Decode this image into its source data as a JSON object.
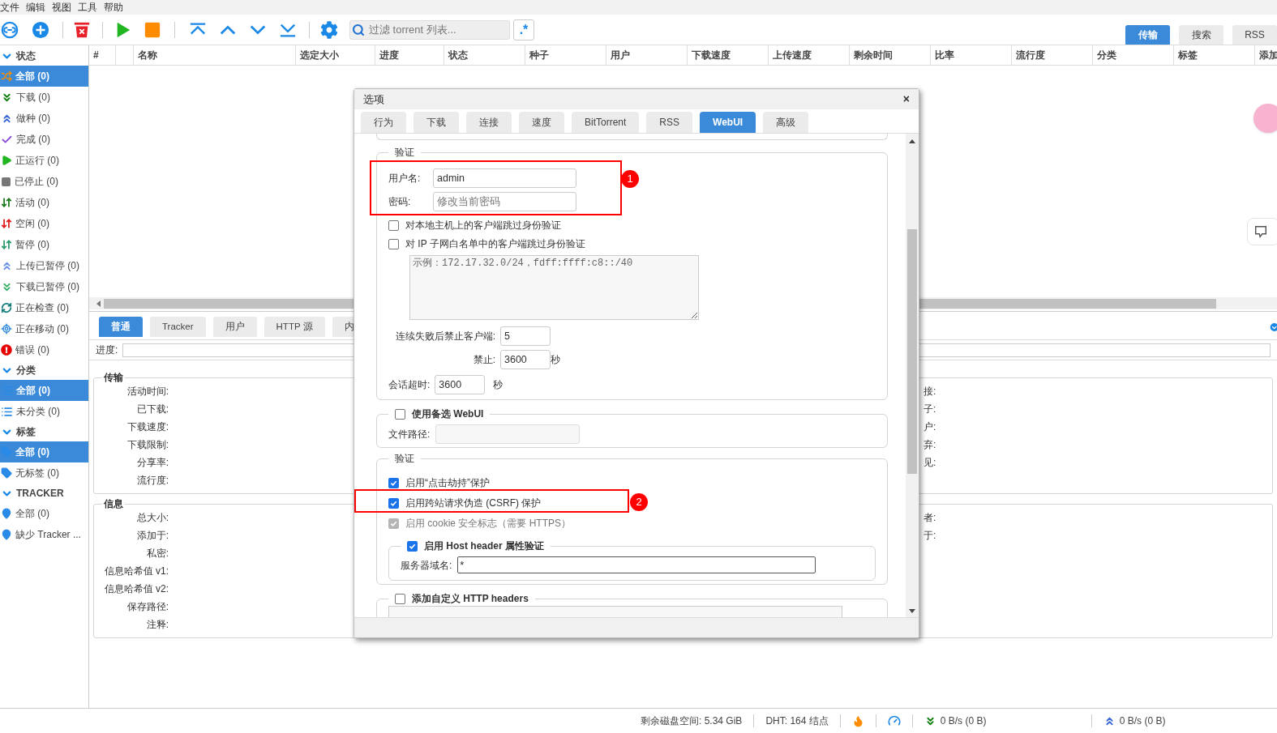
{
  "menu": [
    "文件",
    "编辑",
    "视图",
    "工具",
    "帮助"
  ],
  "toolbar": {
    "filter_placeholder": "过滤 torrent 列表...",
    "regex_button": ".*"
  },
  "view_tabs": [
    {
      "label": "传输",
      "selected": true
    },
    {
      "label": "搜索",
      "selected": false
    },
    {
      "label": "RSS",
      "selected": false
    }
  ],
  "sidebar": [
    {
      "title": "状态",
      "expanded": true,
      "items": [
        {
          "label": "全部 (0)",
          "kind": "all",
          "selected": true
        },
        {
          "label": "下载 (0)",
          "kind": "downloading",
          "selected": false
        },
        {
          "label": "做种 (0)",
          "kind": "seeding",
          "selected": false
        },
        {
          "label": "完成 (0)",
          "kind": "completed",
          "selected": false
        },
        {
          "label": "正运行 (0)",
          "kind": "running",
          "selected": false
        },
        {
          "label": "已停止 (0)",
          "kind": "stopped",
          "selected": false
        },
        {
          "label": "活动 (0)",
          "kind": "active",
          "selected": false
        },
        {
          "label": "空闲 (0)",
          "kind": "inactive",
          "selected": false
        },
        {
          "label": "暂停 (0)",
          "kind": "stalled",
          "selected": false
        },
        {
          "label": "上传已暂停 (0)",
          "kind": "stalled_up",
          "selected": false
        },
        {
          "label": "下载已暂停 (0)",
          "kind": "stalled_down",
          "selected": false
        },
        {
          "label": "正在检查 (0)",
          "kind": "checking",
          "selected": false
        },
        {
          "label": "正在移动 (0)",
          "kind": "moving",
          "selected": false
        },
        {
          "label": "错误 (0)",
          "kind": "error",
          "selected": false
        }
      ]
    },
    {
      "title": "分类",
      "expanded": true,
      "items": [
        {
          "label": "全部 (0)",
          "kind": "list",
          "selected": true
        },
        {
          "label": "未分类 (0)",
          "kind": "list",
          "selected": false
        }
      ]
    },
    {
      "title": "标签",
      "expanded": true,
      "items": [
        {
          "label": "全部 (0)",
          "kind": "tag",
          "selected": true
        },
        {
          "label": "无标签 (0)",
          "kind": "tag",
          "selected": false
        }
      ]
    },
    {
      "title": "TRACKER",
      "expanded": true,
      "items": [
        {
          "label": "全部 (0)",
          "kind": "pin",
          "selected": false
        },
        {
          "label": "缺少 Tracker ...",
          "kind": "pin",
          "selected": false
        }
      ]
    }
  ],
  "table": {
    "columns": [
      "#",
      "名称",
      "选定大小",
      "进度",
      "状态",
      "种子",
      "用户",
      "下载速度",
      "上传速度",
      "剩余时间",
      "比率",
      "流行度",
      "分类",
      "标签",
      "添加"
    ]
  },
  "details": {
    "tabs": [
      {
        "label": "普通",
        "selected": true
      },
      {
        "label": "Tracker",
        "selected": false
      },
      {
        "label": "用户",
        "selected": false
      },
      {
        "label": "HTTP 源",
        "selected": false
      },
      {
        "label": "内",
        "selected": false
      }
    ],
    "progress_label": "进度:",
    "progress": {
      "level": 0
    },
    "transfer": {
      "title": "传输",
      "labels": [
        "活动时间:",
        "已下载:",
        "下载速度:",
        "下载限制:",
        "分享率:",
        "流行度:"
      ],
      "right_labels": [
        "接:",
        "子:",
        "户:",
        "弃:",
        "见:"
      ]
    },
    "info": {
      "title": "信息",
      "labels": [
        "总大小:",
        "添加于:",
        "私密:",
        "信息哈希值 v1:",
        "信息哈希值 v2:",
        "保存路径:",
        "注释:"
      ],
      "right_labels": [
        "者:",
        "于:"
      ]
    }
  },
  "status_bar": {
    "free_space": "剩余磁盘空间: 5.34 GiB",
    "dht": "DHT: 164 结点",
    "download": "0 B/s (0 B)",
    "upload": "0 B/s (0 B)"
  },
  "dialog": {
    "title": "选项",
    "close": "×",
    "tabs": [
      {
        "label": "行为",
        "selected": false
      },
      {
        "label": "下载",
        "selected": false
      },
      {
        "label": "连接",
        "selected": false
      },
      {
        "label": "速度",
        "selected": false
      },
      {
        "label": "BitTorrent",
        "selected": false
      },
      {
        "label": "RSS",
        "selected": false
      },
      {
        "label": "WebUI",
        "selected": true
      },
      {
        "label": "高级",
        "selected": false
      }
    ],
    "auth": {
      "title": "验证",
      "annotation": "1",
      "username_label": "用户名:",
      "username": "admin",
      "password_label": "密码:",
      "password_placeholder": "修改当前密码",
      "options": [
        {
          "label": "对本地主机上的客户端跳过身份验证",
          "checked": false
        },
        {
          "label": "对 IP 子网白名单中的客户端跳过身份验证",
          "checked": false
        }
      ],
      "whitelist_placeholder": "示例：172.17.32.0/24，fdff:ffff:c8::/40",
      "ban_after_label": "连续失败后禁止客户端:",
      "ban_after": "5",
      "ban_label": "禁止:",
      "ban": "3600",
      "ban_unit": "秒",
      "session_label": "会话超时:",
      "session": "3600",
      "session_unit": "秒"
    },
    "alt_webui": {
      "title": "使用备选 WebUI",
      "checked": false,
      "path_label": "文件路径:"
    },
    "security": {
      "title": "验证",
      "options": [
        {
          "label": "启用“点击劫持”保护",
          "checked": true,
          "disabled": false
        },
        {
          "label": "启用跨站请求伪造 (CSRF) 保护",
          "checked": true,
          "disabled": false,
          "annotation": "2"
        },
        {
          "label": "启用 cookie 安全标志（需要 HTTPS）",
          "checked": true,
          "disabled": true
        }
      ],
      "host": {
        "title": "启用 Host header 属性验证",
        "checked": true,
        "domains_label": "服务器域名:",
        "domains": "*"
      }
    },
    "custom_headers": {
      "title": "添加自定义 HTTP headers",
      "checked": false
    }
  }
}
